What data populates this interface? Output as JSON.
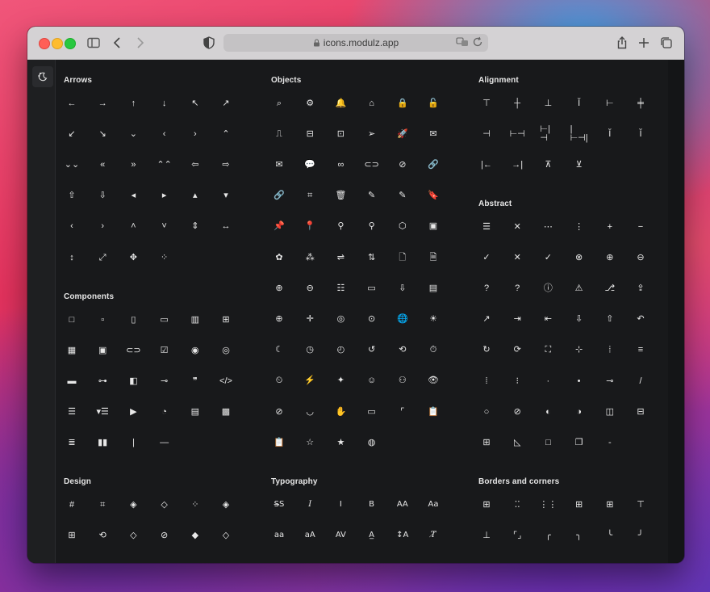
{
  "browser": {
    "url": "icons.modulz.app"
  },
  "sections": {
    "arrows": {
      "title": "Arrows",
      "icons": [
        "arrow-left-icon",
        "arrow-right-icon",
        "arrow-up-icon",
        "arrow-down-icon",
        "arrow-top-left-icon",
        "arrow-top-right-icon",
        "arrow-bottom-left-icon",
        "arrow-bottom-right-icon",
        "chevron-down-icon",
        "chevron-left-icon",
        "chevron-right-icon",
        "chevron-up-icon",
        "double-arrow-down-icon",
        "double-arrow-left-icon",
        "double-arrow-right-icon",
        "double-arrow-up-icon",
        "thick-arrow-left-icon",
        "thick-arrow-right-icon",
        "thick-arrow-up-icon",
        "thick-arrow-down-icon",
        "triangle-left-icon",
        "triangle-right-icon",
        "triangle-up-icon",
        "triangle-down-icon",
        "caret-left-icon",
        "caret-right-icon",
        "caret-up-icon",
        "caret-down-icon",
        "caret-sort-icon",
        "width-icon",
        "height-icon",
        "size-icon",
        "move-icon",
        "all-sides-icon"
      ],
      "glyphs": [
        "←",
        "→",
        "↑",
        "↓",
        "↖",
        "↗",
        "↙",
        "↘",
        "⌄",
        "‹",
        "›",
        "⌃",
        "⌄⌄",
        "«",
        "»",
        "⌃⌃",
        "⇦",
        "⇨",
        "⇧",
        "⇩",
        "◂",
        "▸",
        "▴",
        "▾",
        "‹",
        "›",
        "˄",
        "˅",
        "⇕",
        "↔",
        "↕",
        "⤢",
        "✥",
        "⁘"
      ]
    },
    "components": {
      "title": "Components",
      "icons": [
        "box-icon",
        "aspect-ratio-icon",
        "container-icon",
        "button-icon",
        "columns-icon",
        "grid-icon",
        "table-icon",
        "image-icon",
        "switch-icon",
        "checkbox-icon",
        "radiobutton-icon",
        "avatar-icon",
        "slider-icon",
        "link-icon",
        "input-icon",
        "commit-icon",
        "quote-icon",
        "code-icon",
        "list-bullet-icon",
        "dropdown-menu-icon",
        "video-icon",
        "pie-chart-icon",
        "calendar-icon",
        "dashboard-icon",
        "text-align-icon",
        "bar-chart-icon",
        "divider-vertical-icon",
        "divider-horizontal-icon"
      ],
      "glyphs": [
        "□",
        "▫",
        "▯",
        "▭",
        "▥",
        "⊞",
        "▦",
        "▣",
        "⊂⊃",
        "☑",
        "◉",
        "◎",
        "▬",
        "⊶",
        "◧",
        "⊸",
        "❞",
        "</>",
        "☰",
        "▾☰",
        "▶",
        "◔",
        "▤",
        "▩",
        "≣",
        "▮▮",
        "|",
        "—"
      ]
    },
    "objects": {
      "title": "Objects",
      "icons": [
        "magnifying-glass-icon",
        "gear-icon",
        "bell-icon",
        "home-icon",
        "lock-closed-icon",
        "lock-open-1-icon",
        "lock-open-2-icon",
        "backpack-icon",
        "camera-icon",
        "paper-plane-icon",
        "rocket-icon",
        "envelope-closed-icon",
        "envelope-open-icon",
        "chat-bubble-icon",
        "link-1-icon",
        "link-2-icon",
        "link-break-icon",
        "link-none-icon",
        "link-none-2-icon",
        "lasso-icon",
        "trash-icon",
        "pencil-icon",
        "pencil-square-icon",
        "bookmark-icon",
        "drawing-pin-icon",
        "drawing-pin-filled-icon",
        "sewing-pin-icon",
        "sewing-pin-filled-icon",
        "cube-icon",
        "archive-icon",
        "crumpled-paper-icon",
        "mix-icon",
        "mixer-horizontal-icon",
        "mixer-vertical-icon",
        "file-icon",
        "file-text-icon",
        "file-plus-icon",
        "file-minus-icon",
        "reader-icon",
        "card-stack-icon",
        "card-download-icon",
        "id-card-icon",
        "crosshair-1-icon",
        "crosshair-2-icon",
        "target-icon",
        "globe-icon",
        "disc-icon",
        "sun-icon",
        "moon-icon",
        "clock-icon",
        "timer-icon",
        "countdown-timer-icon",
        "counter-clockwise-icon",
        "stopwatch-icon",
        "lap-timer-icon",
        "lightning-bolt-icon",
        "magic-wand-icon",
        "face-icon",
        "person-icon",
        "eye-open-icon",
        "eye-none-icon",
        "eye-closed-icon",
        "hand-icon",
        "ruler-horizontal-icon",
        "ruler-square-icon",
        "clipboard-icon",
        "clipboard-copy-icon",
        "star-icon",
        "star-filled-icon",
        "backpack-2-icon"
      ],
      "glyphs": [
        "⌕",
        "⚙",
        "🔔",
        "⌂",
        "🔒",
        "🔓",
        "⎍",
        "⊟",
        "⊡",
        "➢",
        "🚀",
        "✉",
        "✉",
        "💬",
        "∞",
        "⊂⊃",
        "⊘",
        "🔗",
        "🔗",
        "⌗",
        "🗑",
        "✎",
        "✎",
        "🔖",
        "📌",
        "📍",
        "⚲",
        "⚲",
        "⬡",
        "▣",
        "✿",
        "⁂",
        "⇌",
        "⇅",
        "🗋",
        "🗎",
        "⊕",
        "⊖",
        "☷",
        "▭",
        "⇩",
        "▤",
        "⊕",
        "✛",
        "◎",
        "⊙",
        "🌐",
        "☀",
        "☾",
        "◷",
        "◴",
        "↺",
        "⟲",
        "⏱",
        "⏲",
        "⚡",
        "✦",
        "☺",
        "⚇",
        "👁",
        "⊘",
        "◡",
        "✋",
        "▭",
        "⌜",
        "📋",
        "📋",
        "☆",
        "★",
        "◍"
      ]
    },
    "typography": {
      "title": "Typography",
      "icons": [
        "strikethrough-icon",
        "font-italic-icon",
        "text-cursor-icon",
        "font-bold-icon",
        "letter-case-uppercase-icon",
        "letter-case-capitalize-icon",
        "letter-case-lowercase-icon",
        "letter-case-toggle-icon",
        "letter-spacing-icon",
        "align-baseline-icon",
        "line-height-icon",
        "text-none-icon"
      ],
      "glyphs": [
        "S̶S",
        "I",
        "I",
        "B",
        "AA",
        "Aa",
        "aa",
        "aA",
        "AV",
        "A̲",
        "↕A",
        "T̸"
      ]
    },
    "alignment": {
      "title": "Alignment",
      "icons": [
        "align-top-icon",
        "align-center-vertically-icon",
        "align-bottom-icon",
        "stretch-vertically-icon",
        "align-left-icon",
        "align-center-horizontally-icon",
        "align-right-icon",
        "stretch-horizontally-icon",
        "space-between-horizontally-icon",
        "space-evenly-horizontally-icon",
        "space-between-vertically-icon",
        "space-evenly-vertically-icon",
        "pin-left-icon",
        "pin-right-icon",
        "pin-top-icon",
        "pin-bottom-icon"
      ],
      "glyphs": [
        "⊤",
        "┼",
        "⊥",
        "Ĭ",
        "⊢",
        "╪",
        "⊣",
        "⊢⊣",
        "⊢|⊣",
        "|⊢⊣|",
        "Ĭ",
        "Ĭ",
        "|←",
        "→|",
        "⊼",
        "⊻"
      ]
    },
    "abstract": {
      "title": "Abstract",
      "icons": [
        "hamburger-menu-icon",
        "cross-1-icon",
        "dots-horizontal-icon",
        "dots-vertical-icon",
        "plus-icon",
        "minus-icon",
        "check-icon",
        "cross-2-icon",
        "check-circled-icon",
        "cross-circled-icon",
        "plus-circled-icon",
        "minus-circled-icon",
        "question-mark-icon",
        "question-mark-circled-icon",
        "info-circled-icon",
        "exclamation-triangle-icon",
        "share-1-icon",
        "share-2-icon",
        "external-link-icon",
        "enter-icon",
        "exit-icon",
        "download-icon",
        "upload-icon",
        "reset-icon",
        "reload-icon",
        "update-icon",
        "enter-full-screen-icon",
        "exit-full-screen-icon",
        "drag-handle-vertical-icon",
        "drag-handle-horizontal-icon",
        "drag-handle-dots-1-icon",
        "drag-handle-dots-2-icon",
        "dot-icon",
        "dot-filled-icon",
        "commit-2-icon",
        "slash-icon",
        "circle-icon",
        "circle-backslash-icon",
        "half-1-icon",
        "half-2-icon",
        "view-vertical-icon",
        "view-horizontal-icon",
        "view-grid-icon",
        "view-none-icon",
        "square-icon",
        "copy-icon",
        "dash-icon"
      ],
      "glyphs": [
        "☰",
        "✕",
        "⋯",
        "⋮",
        "+",
        "−",
        "✓",
        "✕",
        "✓",
        "⊗",
        "⊕",
        "⊖",
        "?",
        "?",
        "ⓘ",
        "⚠",
        "⎇",
        "⇪",
        "↗",
        "⇥",
        "⇤",
        "⇩",
        "⇧",
        "↶",
        "↻",
        "⟳",
        "⛶",
        "⊹",
        "⦙",
        "≡",
        "⁞",
        "⁝",
        "·",
        "•",
        "⊸",
        "/",
        "○",
        "⊘",
        "◐",
        "◑",
        "◫",
        "⊟",
        "⊞",
        "◺",
        "□",
        "❐",
        "-"
      ]
    },
    "design": {
      "title": "Design",
      "icons": [
        "frame-icon",
        "crop-icon",
        "layers-icon",
        "stack-icon",
        "component-1-icon",
        "component-2-icon",
        "component-none-icon",
        "component-instance-icon",
        "component-placeholder-icon",
        "opacity-icon",
        "shadow-icon",
        "transparency-grid-icon"
      ],
      "glyphs": [
        "#",
        "⌗",
        "◈",
        "◇",
        "⁘",
        "◈",
        "⊞",
        "⟲",
        "◇",
        "⊘",
        "◆",
        "◇"
      ]
    },
    "borders": {
      "title": "Borders and corners",
      "icons": [
        "border-all-icon",
        "border-split-icon",
        "border-none-icon",
        "border-left-icon",
        "border-right-icon",
        "border-top-icon",
        "border-bottom-icon",
        "corners-icon",
        "corner-top-left-icon",
        "corner-top-right-icon",
        "corner-bottom-left-icon",
        "corner-bottom-right-icon"
      ],
      "glyphs": [
        "⊞",
        "⁚⁚",
        "⋮⋮",
        "⊞",
        "⊞",
        "⊤",
        "⊥",
        "⌜⌟",
        "╭",
        "╮",
        "╰",
        "╯"
      ]
    }
  }
}
